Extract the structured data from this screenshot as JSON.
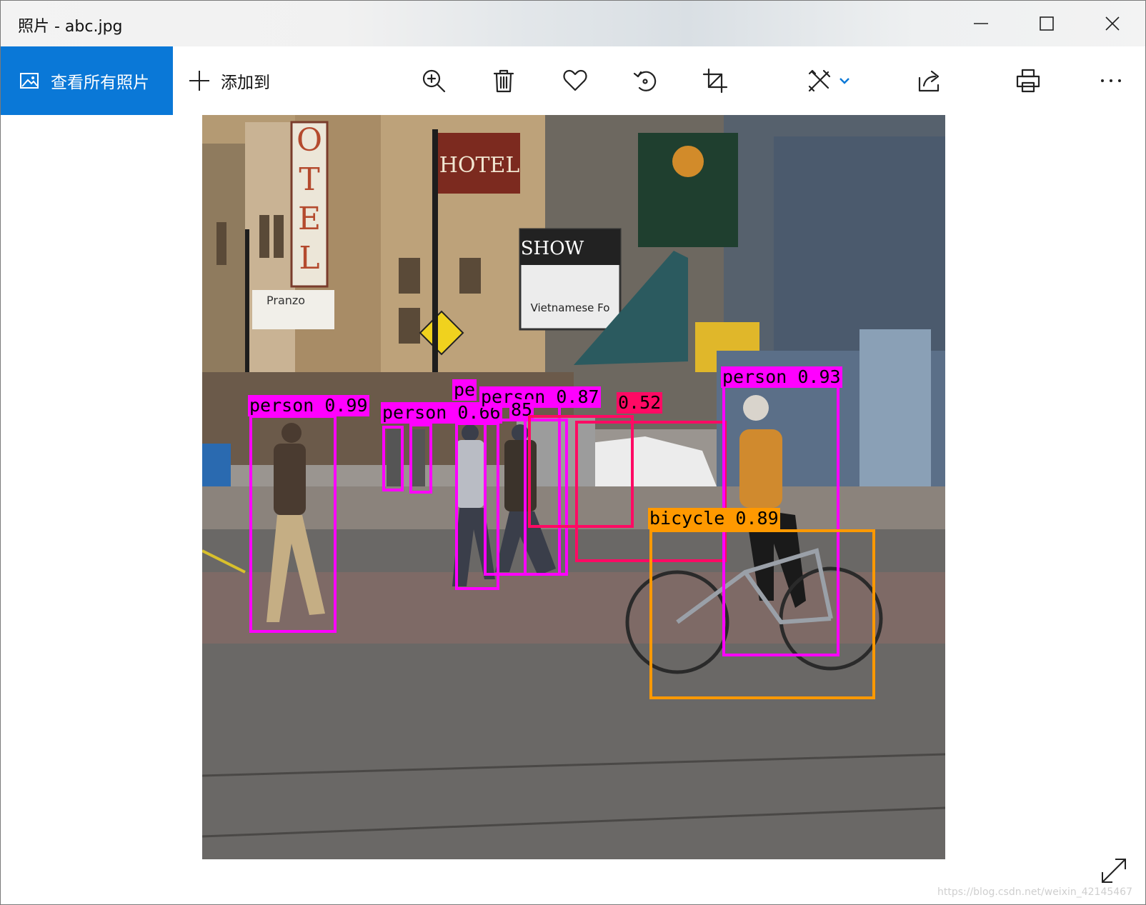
{
  "window": {
    "title": "照片 - abc.jpg",
    "controls": {
      "minimize_icon": "minimize-icon",
      "maximize_icon": "maximize-icon",
      "close_icon": "close-icon"
    }
  },
  "toolbar": {
    "view_all_label": "查看所有照片",
    "add_to_label": "添加到",
    "accent_color": "#0a78d7",
    "tools": [
      "zoom-in-icon",
      "delete-icon",
      "favorite-icon",
      "rotate-icon",
      "crop-icon",
      "edit-draw-icon",
      "share-icon",
      "print-icon",
      "more-icon"
    ]
  },
  "detections": [
    {
      "label": "person 0.99",
      "color": "#ff00ff"
    },
    {
      "label": "person 0.66",
      "color": "#ff00ff"
    },
    {
      "label": "pe",
      "color": "#ff00ff"
    },
    {
      "label": "person 0.87",
      "color": "#ff00ff"
    },
    {
      "label": "85",
      "color": "#ff00ff"
    },
    {
      "label": "0.52",
      "color": "#ff0a64"
    },
    {
      "label": "person 0.93",
      "color": "#ff00ff"
    },
    {
      "label": "bicycle 0.89",
      "color": "#ff9900"
    }
  ],
  "watermark": "https://blog.csdn.net/weixin_42145467"
}
